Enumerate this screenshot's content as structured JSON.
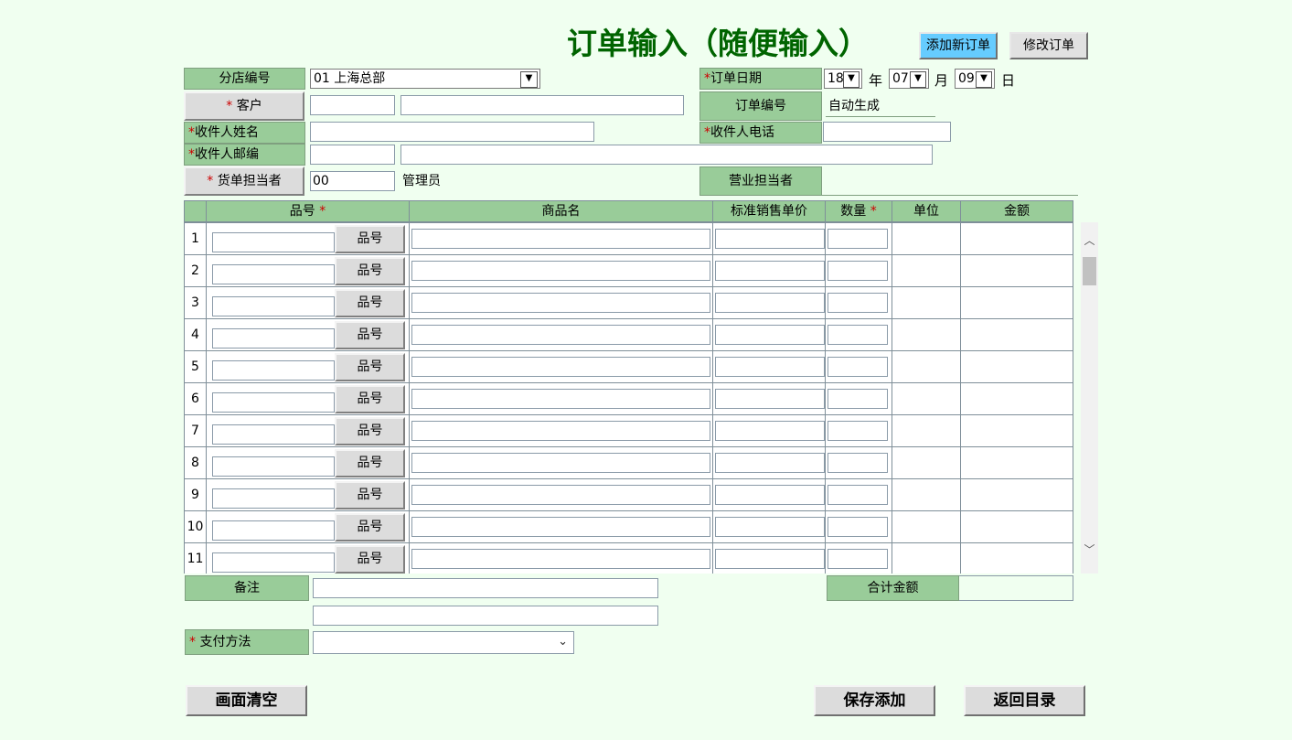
{
  "header": {
    "title": "订单输入（随便输入）",
    "add_new_label": "添加新订单",
    "edit_label": "修改订单"
  },
  "form": {
    "branch_label": "分店编号",
    "branch_value": "01  上海总部",
    "order_date_label": "订单日期",
    "year_value": "18",
    "year_unit": "年",
    "month_value": "07",
    "month_unit": "月",
    "day_value": "09",
    "day_unit": "日",
    "customer_label": "客户",
    "order_no_label": "订单编号",
    "order_no_value": "自动生成",
    "recipient_name_label": "收件人姓名",
    "recipient_phone_label": "收件人电话",
    "recipient_zip_label": "收件人邮编",
    "staff_label": "货单担当者",
    "staff_code": "00",
    "staff_name": "管理员",
    "sales_staff_label": "营业担当者",
    "required_mark": "*"
  },
  "grid": {
    "headers": {
      "item_no": "品号",
      "name": "商品名",
      "price": "标准销售单价",
      "qty": "数量",
      "unit": "单位",
      "amount": "金额"
    },
    "lookup_label": "品号",
    "rows": [
      "1",
      "2",
      "3",
      "4",
      "5",
      "6",
      "7",
      "8",
      "9",
      "10",
      "11"
    ]
  },
  "footer": {
    "remark_label": "备注",
    "total_label": "合计金额",
    "payment_label": "支付方法",
    "clear_label": "画面清空",
    "save_label": "保存添加",
    "back_label": "返回目录"
  },
  "colors": {
    "background": "#f0fff0",
    "label_bg": "#99cc99",
    "title": "#006400",
    "accent_button": "#66ccff",
    "required": "#cc0000"
  }
}
